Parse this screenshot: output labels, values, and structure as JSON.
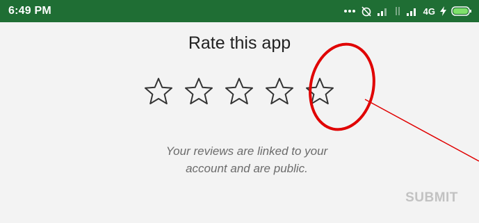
{
  "status_bar": {
    "time": "6:49 PM",
    "network": "4G",
    "background_color": "#1f6e34",
    "icons": [
      "more-dots-icon",
      "alarm-off-icon",
      "signal-icon",
      "data-arrows-icon",
      "signal-icon",
      "charging-bolt-icon",
      "battery-icon"
    ]
  },
  "dialog": {
    "title": "Rate this app",
    "rating": {
      "max": 5,
      "selected": 0,
      "star_icon": "star-outline-icon"
    },
    "note_line1": "Your reviews are linked to your",
    "note_line2": "account and are public.",
    "submit_label": "SUBMIT"
  },
  "annotation": {
    "color": "#e00000",
    "shape": "ellipse-with-pointer-line",
    "highlights": "fifth star"
  }
}
